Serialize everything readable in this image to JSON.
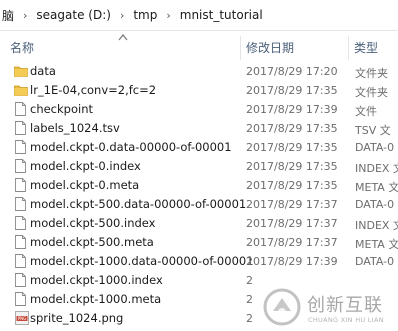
{
  "breadcrumb": {
    "items": [
      "脑",
      "seagate (D:)",
      "tmp",
      "mnist_tutorial"
    ],
    "separator": "›"
  },
  "columns": {
    "name": "名称",
    "date": "修改日期",
    "type": "类型"
  },
  "files": [
    {
      "name": "data",
      "date": "2017/8/29 17:20",
      "type": "文件夹",
      "icon": "folder-icon"
    },
    {
      "name": "lr_1E-04,conv=2,fc=2",
      "date": "2017/8/29 17:35",
      "type": "文件夹",
      "icon": "folder-icon"
    },
    {
      "name": "checkpoint",
      "date": "2017/8/29 17:39",
      "type": "文件",
      "icon": "file-icon"
    },
    {
      "name": "labels_1024.tsv",
      "date": "2017/8/29 17:35",
      "type": "TSV 文",
      "icon": "file-icon"
    },
    {
      "name": "model.ckpt-0.data-00000-of-00001",
      "date": "2017/8/29 17:35",
      "type": "DATA-0",
      "icon": "file-icon"
    },
    {
      "name": "model.ckpt-0.index",
      "date": "2017/8/29 17:35",
      "type": "INDEX 文",
      "icon": "file-icon"
    },
    {
      "name": "model.ckpt-0.meta",
      "date": "2017/8/29 17:35",
      "type": "META 文",
      "icon": "file-icon"
    },
    {
      "name": "model.ckpt-500.data-00000-of-00001",
      "date": "2017/8/29 17:37",
      "type": "DATA-0",
      "icon": "file-icon"
    },
    {
      "name": "model.ckpt-500.index",
      "date": "2017/8/29 17:37",
      "type": "INDEX 文",
      "icon": "file-icon"
    },
    {
      "name": "model.ckpt-500.meta",
      "date": "2017/8/29 17:37",
      "type": "META 文",
      "icon": "file-icon"
    },
    {
      "name": "model.ckpt-1000.data-00000-of-00001",
      "date": "2017/8/29 17:39",
      "type": "DATA-0",
      "icon": "file-icon"
    },
    {
      "name": "model.ckpt-1000.index",
      "date": "2",
      "type": "",
      "icon": "file-icon"
    },
    {
      "name": "model.ckpt-1000.meta",
      "date": "2",
      "type": "",
      "icon": "file-icon"
    },
    {
      "name": "sprite_1024.png",
      "date": "2",
      "type": "",
      "icon": "png-icon"
    }
  ],
  "watermark": {
    "title": "创新互联",
    "subtitle": "CHUANG XIN HU LIAN"
  },
  "colors": {
    "folder": "#e8b93a",
    "header_text": "#4c607a",
    "secondary_text": "#6d6d6d",
    "png_badge": "#c94a3a"
  }
}
